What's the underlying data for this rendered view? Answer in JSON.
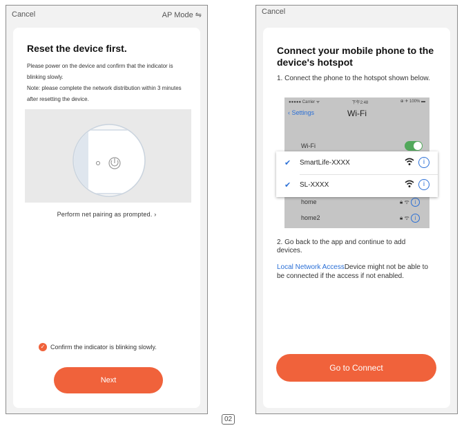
{
  "left_screen": {
    "cancel_label": "Cancel",
    "ap_mode_label": "AP Mode ⇋",
    "title": "Reset the device first.",
    "description_1": "Please power on the device and confirm that the indicator is blinking slowly.",
    "description_2": "Note: please complete the network distribution within 3 minutes after resetting the device.",
    "pairing_link": "Perform net pairing as prompted. ›",
    "confirm_label": "Confirm the indicator is blinking slowly.",
    "confirm_checked": true,
    "next_button": "Next"
  },
  "right_screen": {
    "cancel_label": "Cancel",
    "title": "Connect your mobile phone to the device's hotspot",
    "step_1": "1. Connect the phone to the hotspot shown below.",
    "wifi_screenshot": {
      "carrier": "●●●●● Carrier ᯤ",
      "time": "下午2:48",
      "battery": "⊕ ✈ 100% ▬",
      "back_label": "Settings",
      "title": "Wi-Fi",
      "wifi_toggle_label": "Wi-Fi",
      "highlighted_networks": [
        {
          "name": "SmartLife-XXXX"
        },
        {
          "name": "SL-XXXX"
        }
      ],
      "other_networks": [
        {
          "name": "home"
        },
        {
          "name": "home2"
        }
      ]
    },
    "step_2": "2. Go back to the app and continue to add devices.",
    "local_network_link": "Local Network Access",
    "local_network_text": "Device might not be able to be connected if the access if not enabled.",
    "connect_button": "Go to Connect"
  },
  "page_number": "02",
  "colors": {
    "accent": "#f0623b",
    "link": "#2a6fd6",
    "toggle_on": "#52a85b"
  }
}
